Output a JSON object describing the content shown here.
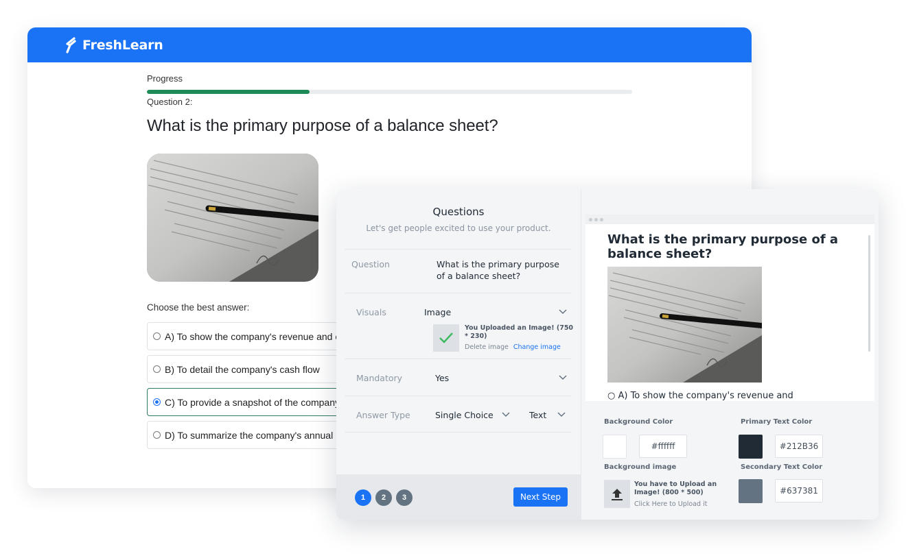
{
  "brand": {
    "name": "FreshLearn",
    "color": "#1A73F5"
  },
  "quiz": {
    "progress_label": "Progress",
    "progress_fraction": 0.335,
    "question_number": "Question 2:",
    "question_text": "What is the primary purpose of a balance sheet?",
    "choose_label": "Choose the best answer:",
    "answers": [
      {
        "label": "A) To show the company's revenue and exp",
        "selected": false
      },
      {
        "label": "B) To detail the company's cash flow",
        "selected": false
      },
      {
        "label": "C) To provide a snapshot of the company's",
        "selected": true
      },
      {
        "label": "D) To summarize the company's annual bu",
        "selected": false
      }
    ]
  },
  "builder": {
    "title": "Questions",
    "subtitle": "Let's get people excited to use your product.",
    "question": {
      "label": "Question",
      "value": "What is the primary purpose of a balance sheet?"
    },
    "visuals": {
      "label": "Visuals",
      "value": "Image",
      "upload_message": "You Uploaded an Image! (750 * 230)",
      "delete_label": "Delete image",
      "change_label": "Change image"
    },
    "mandatory": {
      "label": "Mandatory",
      "value": "Yes"
    },
    "answer_type": {
      "label": "Answer Type",
      "value": "Single Choice",
      "format": "Text"
    },
    "steps": [
      "1",
      "2",
      "3"
    ],
    "active_step": 1,
    "next_label": "Next Step"
  },
  "preview": {
    "question": "What is the primary purpose of a balance sheet?",
    "cut_answer": "○ A) To show the company's revenue and"
  },
  "settings": {
    "background_color_label": "Background Color",
    "background_color": "#ffffff",
    "primary_text_color_label": "Primary Text Color",
    "primary_text_color": "#212B36",
    "background_image_label": "Background image",
    "background_image_message": "You have to Upload an Image! (800 * 500)",
    "background_image_link": "Click Here to Upload it",
    "secondary_text_color_label": "Secondary Text Color",
    "secondary_text_color": "#637381"
  }
}
